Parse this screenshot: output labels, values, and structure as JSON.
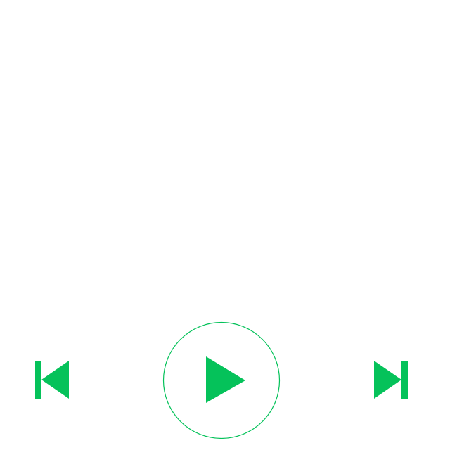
{
  "player": {
    "controls": [
      {
        "id": "previous",
        "icon": "skip-previous-icon"
      },
      {
        "id": "play",
        "icon": "play-icon"
      },
      {
        "id": "next",
        "icon": "skip-next-icon"
      }
    ],
    "state": "paused"
  },
  "colors": {
    "background": "#ffffff",
    "accent": "#05C25A",
    "ring": "#05C25A"
  }
}
